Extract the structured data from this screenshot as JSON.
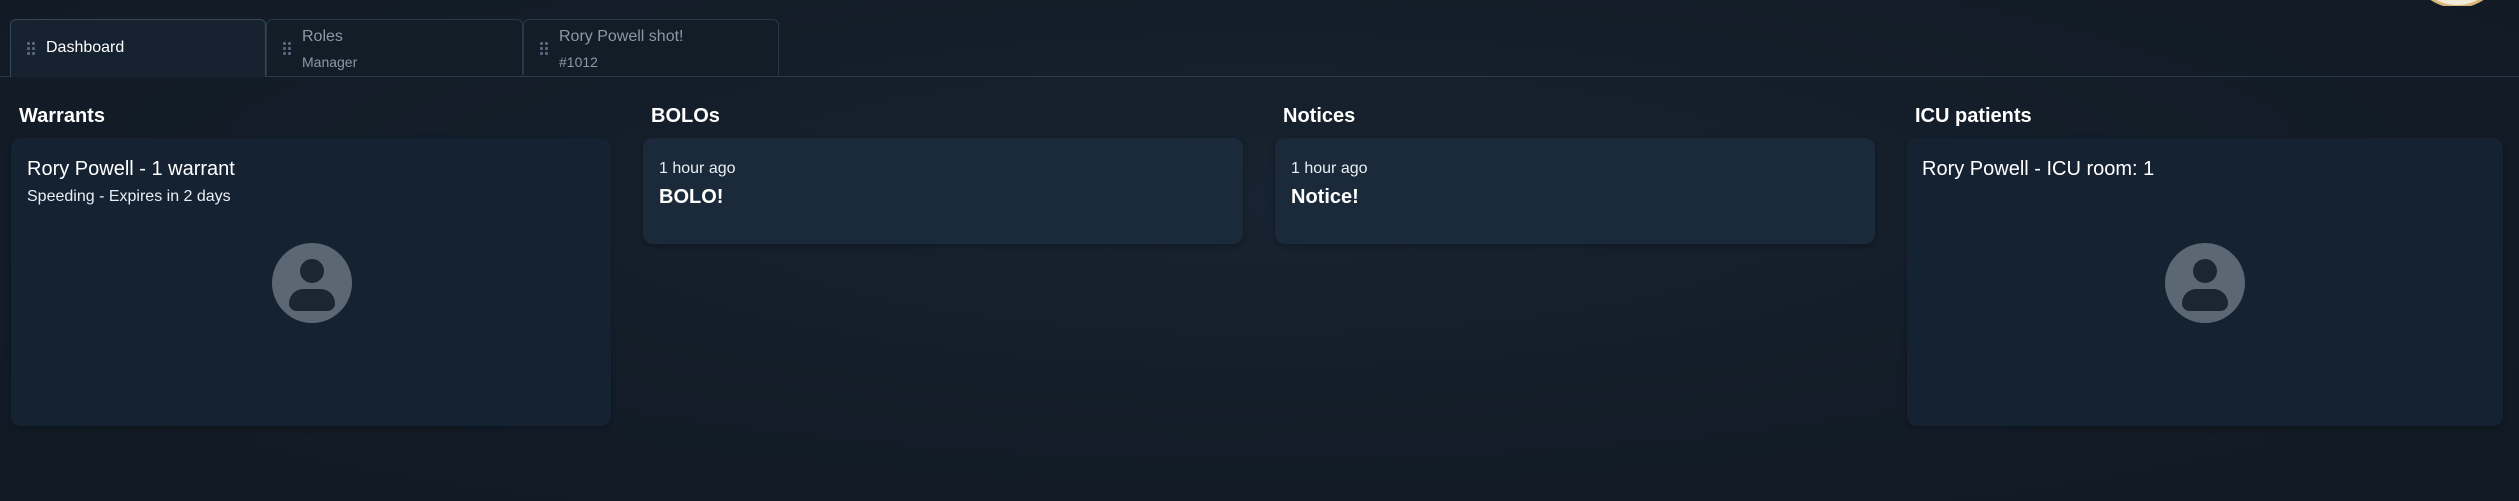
{
  "tabs": [
    {
      "title": "Dashboard",
      "subtitle": "",
      "active": true
    },
    {
      "title": "Roles",
      "subtitle": "Manager",
      "active": false
    },
    {
      "title": "Rory Powell shot!",
      "subtitle": "#1012",
      "active": false
    }
  ],
  "columns": {
    "warrants": {
      "heading": "Warrants",
      "card": {
        "title": "Rory Powell - 1 warrant",
        "subtitle": "Speeding - Expires in 2 days",
        "avatar_icon": "user-placeholder-icon"
      }
    },
    "bolos": {
      "heading": "BOLOs",
      "card": {
        "time": "1 hour ago",
        "text": "BOLO!"
      }
    },
    "notices": {
      "heading": "Notices",
      "card": {
        "time": "1 hour ago",
        "text": "Notice!"
      }
    },
    "icu": {
      "heading": "ICU patients",
      "card": {
        "title": "Rory Powell - ICU room: 1",
        "avatar_icon": "user-placeholder-icon"
      }
    }
  },
  "colors": {
    "background": "#141e29",
    "card": "#182533",
    "accent_border": "#d8b77a"
  }
}
